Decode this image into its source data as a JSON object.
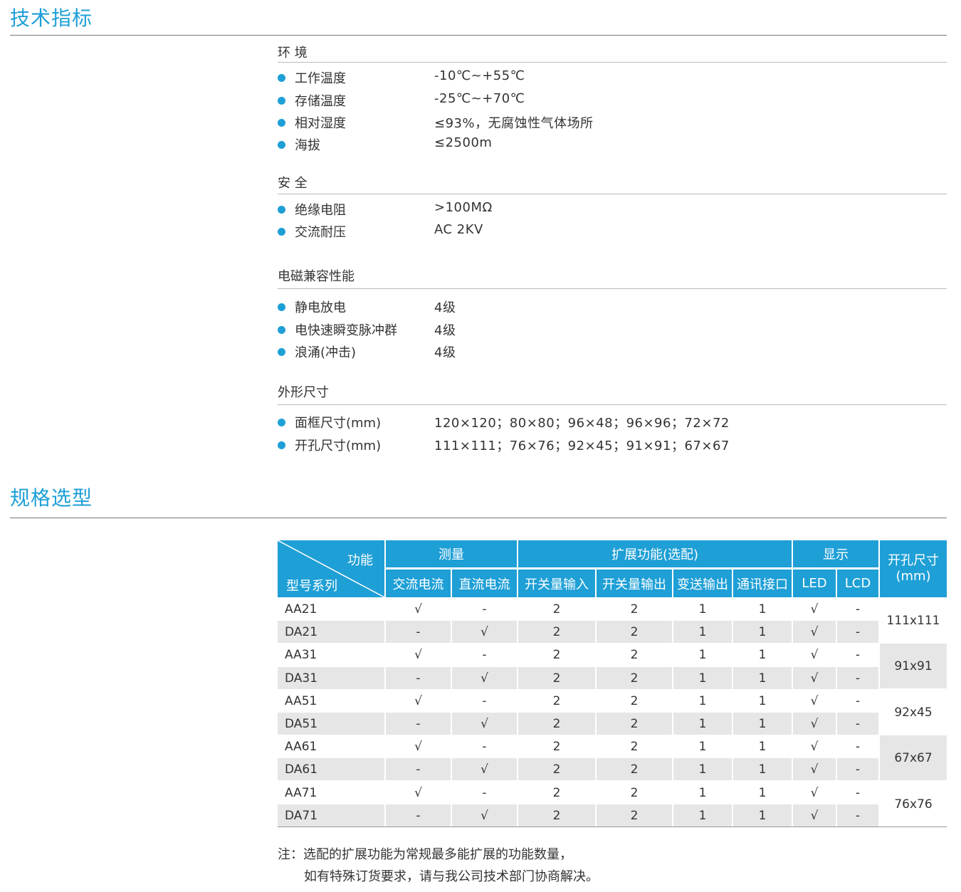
{
  "section1": {
    "title": "技术指标"
  },
  "groups": [
    {
      "title": "环 境",
      "items": [
        {
          "label": "工作温度",
          "value": "-10℃~+55℃"
        },
        {
          "label": "存储温度",
          "value": "-25℃~+70℃"
        },
        {
          "label": "相对湿度",
          "value": "≤93%，无腐蚀性气体场所"
        },
        {
          "label": "海拔",
          "value": "≤2500m"
        }
      ]
    },
    {
      "title": "安 全",
      "items": [
        {
          "label": "绝缘电阻",
          "value": ">100MΩ"
        },
        {
          "label": "交流耐压",
          "value": "AC 2KV"
        }
      ]
    },
    {
      "title": "电磁兼容性能",
      "items": [
        {
          "label": "静电放电",
          "value": "4级"
        },
        {
          "label": "电快速瞬变脉冲群",
          "value": "4级"
        },
        {
          "label": "浪涌(冲击)",
          "value": "4级"
        }
      ]
    },
    {
      "title": "外形尺寸",
      "items": [
        {
          "label": "面框尺寸(mm)",
          "value": "120×120；80×80；96×48；96×96；72×72"
        },
        {
          "label": "开孔尺寸(mm)",
          "value": "111×111；76×76；92×45；91×91；67×67"
        }
      ]
    }
  ],
  "section2": {
    "title": "规格选型"
  },
  "table": {
    "corner_top": "功能",
    "corner_bottom": "型号系列",
    "group_headers": [
      "测量",
      "扩展功能(选配)",
      "显示"
    ],
    "cutout_header": "开孔尺寸\n(mm)",
    "sub_headers": [
      "交流电流",
      "直流电流",
      "开关量输入",
      "开关量输出",
      "变送输出",
      "通讯接口",
      "LED",
      "LCD"
    ],
    "rows": [
      {
        "model": "AA21",
        "cells": [
          "√",
          "-",
          "2",
          "2",
          "1",
          "1",
          "√",
          "-"
        ]
      },
      {
        "model": "DA21",
        "cells": [
          "-",
          "√",
          "2",
          "2",
          "1",
          "1",
          "√",
          "-"
        ]
      },
      {
        "model": "AA31",
        "cells": [
          "√",
          "-",
          "2",
          "2",
          "1",
          "1",
          "√",
          "-"
        ]
      },
      {
        "model": "DA31",
        "cells": [
          "-",
          "√",
          "2",
          "2",
          "1",
          "1",
          "√",
          "-"
        ]
      },
      {
        "model": "AA51",
        "cells": [
          "√",
          "-",
          "2",
          "2",
          "1",
          "1",
          "√",
          "-"
        ]
      },
      {
        "model": "DA51",
        "cells": [
          "-",
          "√",
          "2",
          "2",
          "1",
          "1",
          "√",
          "-"
        ]
      },
      {
        "model": "AA61",
        "cells": [
          "√",
          "-",
          "2",
          "2",
          "1",
          "1",
          "√",
          "-"
        ]
      },
      {
        "model": "DA61",
        "cells": [
          "-",
          "√",
          "2",
          "2",
          "1",
          "1",
          "√",
          "-"
        ]
      },
      {
        "model": "AA71",
        "cells": [
          "√",
          "-",
          "2",
          "2",
          "1",
          "1",
          "√",
          "-"
        ]
      },
      {
        "model": "DA71",
        "cells": [
          "-",
          "√",
          "2",
          "2",
          "1",
          "1",
          "√",
          "-"
        ]
      }
    ],
    "cutouts": [
      "111x111",
      "91x91",
      "92x45",
      "67x67",
      "76x76"
    ]
  },
  "note": {
    "line1": "注：选配的扩展功能为常规最多能扩展的功能数量，",
    "line2": "如有特殊订货要求，请与我公司技术部门协商解决。"
  },
  "colors": {
    "accent": "#1e9fd6",
    "row_shade": "#e6e6e6"
  }
}
